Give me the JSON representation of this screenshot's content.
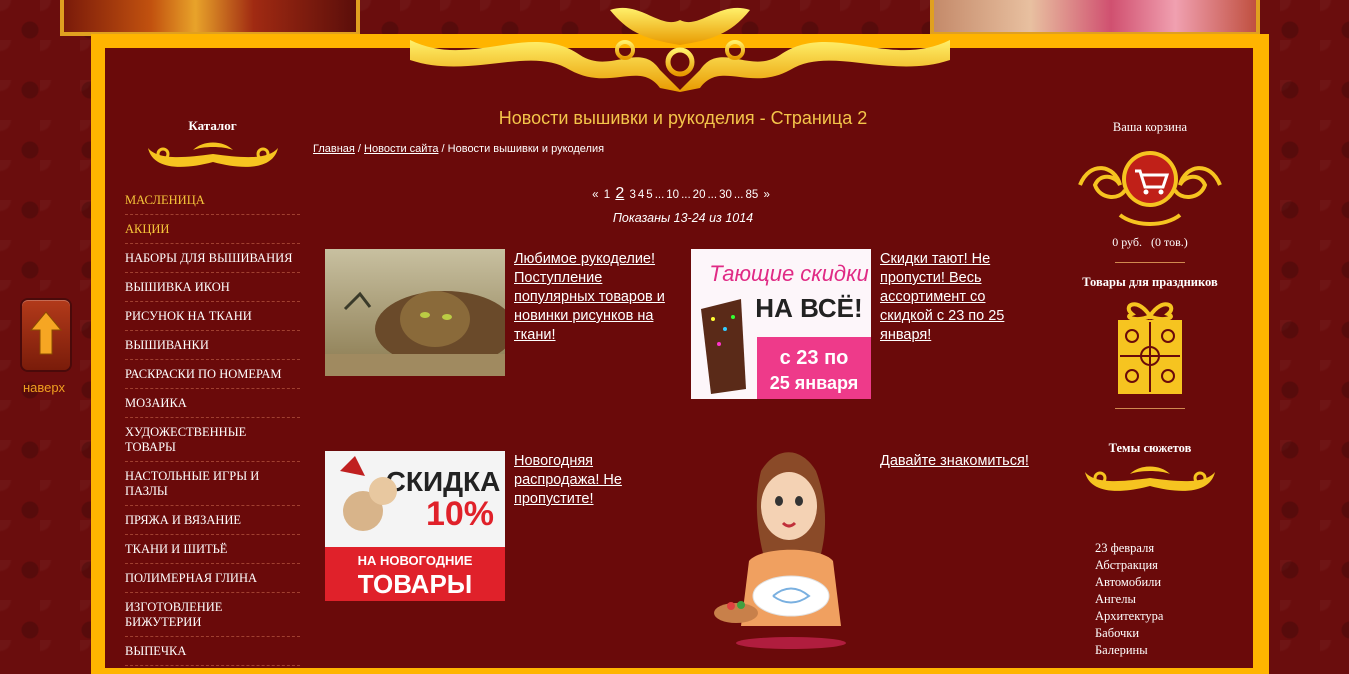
{
  "nav": {
    "to_top_label": "наверх"
  },
  "left": {
    "title": "Каталог",
    "items": [
      {
        "label": "МАСЛЕНИЦА",
        "hl": true
      },
      {
        "label": "АКЦИИ",
        "hl": true
      },
      {
        "label": "НАБОРЫ ДЛЯ ВЫШИВАНИЯ"
      },
      {
        "label": "ВЫШИВКА ИКОН"
      },
      {
        "label": "РИСУНОК НА ТКАНИ"
      },
      {
        "label": "ВЫШИВАНКИ"
      },
      {
        "label": "РАСКРАСКИ ПО НОМЕРАМ"
      },
      {
        "label": "МОЗАИКА"
      },
      {
        "label": "ХУДОЖЕСТВЕННЫЕ ТОВАРЫ"
      },
      {
        "label": "НАСТОЛЬНЫЕ ИГРЫ И ПАЗЛЫ"
      },
      {
        "label": "ПРЯЖА И ВЯЗАНИЕ"
      },
      {
        "label": "ТКАНИ И ШИТЬЁ"
      },
      {
        "label": "ПОЛИМЕРНАЯ ГЛИНА"
      },
      {
        "label": "ИЗГОТОВЛЕНИЕ БИЖУТЕРИИ"
      },
      {
        "label": "ВЫПЕЧКА"
      }
    ]
  },
  "main": {
    "title": "Новости вышивки и рукоделия - Страница 2",
    "breadcrumb": {
      "home": "Главная",
      "sep1": " / ",
      "news": "Новости сайта",
      "sep2": " / ",
      "current": "Новости вышивки и рукоделия"
    },
    "pager": {
      "prev": "«",
      "p1": "1",
      "cur": "2",
      "p3": "3",
      "p4": "4",
      "p5": "5",
      "e1": "...",
      "p10": "10",
      "e2": "...",
      "p20": "20",
      "e3": "...",
      "p30": "30",
      "e4": "...",
      "p85": "85",
      "next": "»"
    },
    "shown": "Показаны 13-24 из 1014",
    "news": [
      {
        "title": "Любимое рукоделие! Поступление популярных товаров и новинки рисунков на ткани!"
      },
      {
        "title": "Скидки тают! Не пропусти! Весь ассортимент со скидкой с 23 по 25 января!",
        "img_text": {
          "l1": "Тающие скидки",
          "l2": "НА ВСЁ!",
          "l3": "с 23 по",
          "l4": "25 января"
        }
      },
      {
        "title": "Новогодняя распродажа! Не пропустите!",
        "img_text": {
          "l1": "СКИДКА",
          "l2": "10%",
          "l3": "НА НОВОГОДНИЕ",
          "l4": "ТОВАРЫ"
        }
      },
      {
        "title": "Давайте знакомиться!"
      }
    ]
  },
  "right": {
    "cart_title": "Ваша корзина",
    "cart_sum": "0 руб.",
    "cart_count": "(0 тов.)",
    "holidays_title": "Товары для праздников",
    "themes_title": "Темы сюжетов",
    "themes": [
      "23 февраля",
      "Абстракция",
      "Автомобили",
      "Ангелы",
      "Архитектура",
      "Бабочки",
      "Балерины"
    ]
  },
  "colors": {
    "bg": "#6a0a0a",
    "frame": "#ffb400",
    "accent": "#f4c54a"
  }
}
